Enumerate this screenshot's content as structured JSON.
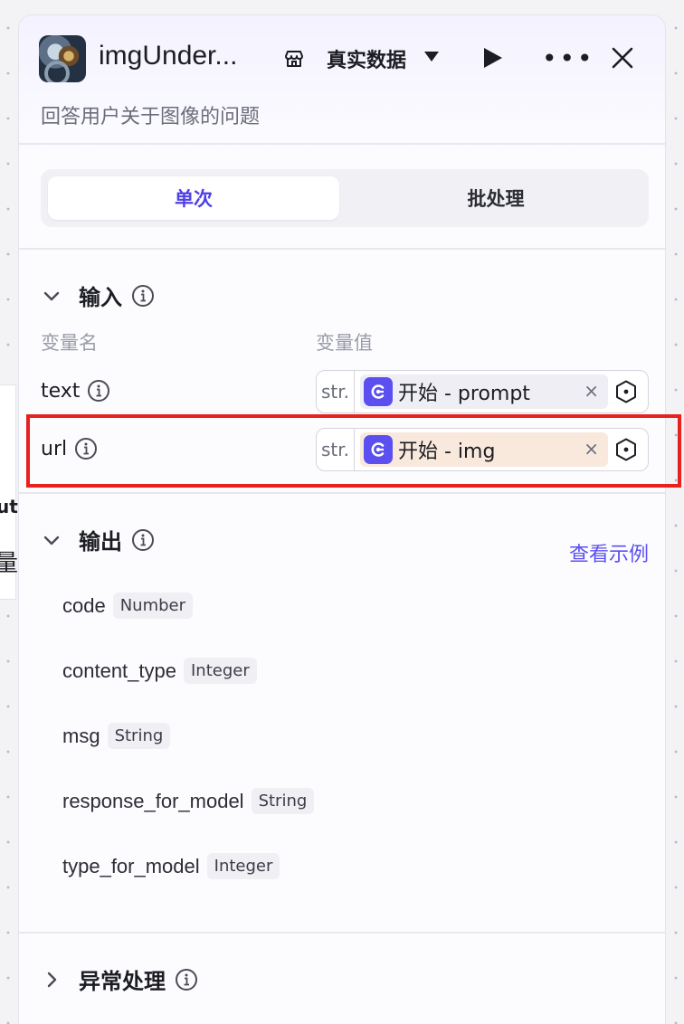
{
  "background_node": {
    "text_fragment": "ut",
    "label_fragment": "量"
  },
  "header": {
    "title": "imgUnder...",
    "data_select": "真实数据",
    "subtitle": "回答用户关于图像的问题"
  },
  "mode_tabs": [
    {
      "label": "单次",
      "active": true
    },
    {
      "label": "批处理",
      "active": false
    }
  ],
  "input_section": {
    "title": "输入",
    "col_name_label": "变量名",
    "col_value_label": "变量值",
    "rows": [
      {
        "name": "text",
        "type": "str.",
        "ref": "开始 - prompt"
      },
      {
        "name": "url",
        "type": "str.",
        "ref": "开始 - img"
      }
    ]
  },
  "output_section": {
    "title": "输出",
    "example_link": "查看示例",
    "items": [
      {
        "name": "code",
        "type": "Number"
      },
      {
        "name": "content_type",
        "type": "Integer"
      },
      {
        "name": "msg",
        "type": "String"
      },
      {
        "name": "response_for_model",
        "type": "String"
      },
      {
        "name": "type_for_model",
        "type": "Integer"
      }
    ]
  },
  "exception_section": {
    "title": "异常处理"
  },
  "colors": {
    "accent": "#5b4ff0",
    "highlight": "#e8201e",
    "chip_peach": "#f9e9dd"
  }
}
